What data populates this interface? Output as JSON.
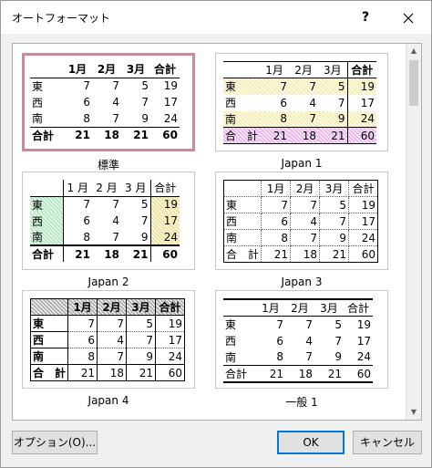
{
  "window": {
    "title": "オートフォーマット",
    "help_label": "?"
  },
  "formats": [
    {
      "name": "標準",
      "headers": [
        "",
        "1月",
        "2月",
        "3月",
        "合計"
      ],
      "rows": [
        [
          "東",
          "7",
          "7",
          "5",
          "19"
        ],
        [
          "西",
          "6",
          "4",
          "7",
          "17"
        ],
        [
          "南",
          "8",
          "7",
          "9",
          "24"
        ]
      ],
      "total": [
        "合計",
        "21",
        "18",
        "21",
        "60"
      ]
    },
    {
      "name": "Japan 1",
      "headers": [
        "",
        "1月",
        "2月",
        "3月",
        "合計"
      ],
      "rows": [
        [
          "東",
          "7",
          "7",
          "5",
          "19"
        ],
        [
          "西",
          "6",
          "4",
          "7",
          "17"
        ],
        [
          "南",
          "8",
          "7",
          "9",
          "24"
        ]
      ],
      "total": [
        "合　計",
        "21",
        "18",
        "21",
        "60"
      ]
    },
    {
      "name": "Japan 2",
      "headers": [
        "",
        "1 月",
        "2 月",
        "3 月",
        "合計"
      ],
      "rows": [
        [
          "東",
          "7",
          "7",
          "5",
          "19"
        ],
        [
          "西",
          "6",
          "4",
          "7",
          "17"
        ],
        [
          "南",
          "8",
          "7",
          "9",
          "24"
        ]
      ],
      "total": [
        "合計",
        "21",
        "18",
        "21",
        "60"
      ]
    },
    {
      "name": "Japan 3",
      "headers": [
        "",
        "1月",
        "2月",
        "3月",
        "合計"
      ],
      "rows": [
        [
          "東",
          "7",
          "7",
          "5",
          "19"
        ],
        [
          "西",
          "6",
          "4",
          "7",
          "17"
        ],
        [
          "南",
          "8",
          "7",
          "9",
          "24"
        ]
      ],
      "total": [
        "合　計",
        "21",
        "18",
        "21",
        "60"
      ]
    },
    {
      "name": "Japan 4",
      "headers": [
        "",
        "1月",
        "2月",
        "3月",
        "合計"
      ],
      "rows": [
        [
          "東",
          "7",
          "7",
          "5",
          "19"
        ],
        [
          "西",
          "6",
          "4",
          "7",
          "17"
        ],
        [
          "南",
          "8",
          "7",
          "9",
          "24"
        ]
      ],
      "total": [
        "合　計",
        "21",
        "18",
        "21",
        "60"
      ]
    },
    {
      "name": "一般 1",
      "headers": [
        "",
        "1月",
        "2月",
        "3月",
        "合計"
      ],
      "rows": [
        [
          "東",
          "7",
          "7",
          "5",
          "19"
        ],
        [
          "西",
          "6",
          "4",
          "7",
          "17"
        ],
        [
          "南",
          "8",
          "7",
          "9",
          "24"
        ]
      ],
      "total": [
        "合計",
        "21",
        "18",
        "21",
        "60"
      ]
    }
  ],
  "selected_format": "標準",
  "buttons": {
    "options": "オプション(O)...",
    "ok": "OK",
    "cancel": "キャンセル"
  },
  "colors": {
    "selection_border": "#c98a98",
    "default_button_border": "#0078d7"
  }
}
